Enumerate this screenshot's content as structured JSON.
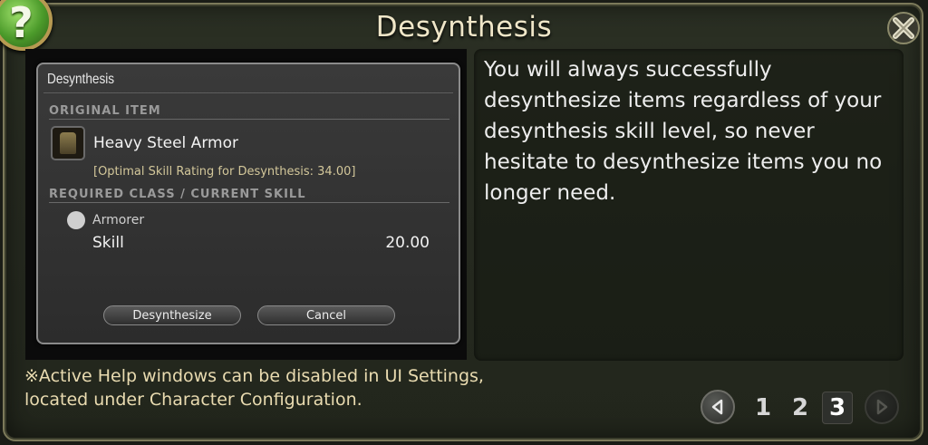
{
  "window": {
    "title": "Desynthesis"
  },
  "dialog": {
    "title": "Desynthesis",
    "original_item_header": "ORIGINAL ITEM",
    "item_name": "Heavy Steel Armor",
    "optimal_rating": "[Optimal Skill Rating for Desynthesis: 34.00]",
    "required_header": "REQUIRED CLASS / CURRENT SKILL",
    "class_name": "Armorer",
    "skill_label": "Skill",
    "skill_value": "20.00",
    "desynthesize_label": "Desynthesize",
    "cancel_label": "Cancel"
  },
  "help_text": "You will always successfully desynthesize items regardless of your desynthesis skill level, so never hesitate to desynthesize items you no longer need.",
  "note": {
    "line1": "※Active Help windows can be disabled in UI Settings,",
    "line2": "located under Character Configuration."
  },
  "pager": {
    "pages": [
      "1",
      "2",
      "3"
    ],
    "current": "3"
  },
  "icons": {
    "help": "question-mark-icon",
    "close": "close-cross-icon",
    "prev": "triangle-left-icon",
    "next": "triangle-right-icon"
  },
  "colors": {
    "accent_gold": "#e9dbb0",
    "help_green": "#4b9a2a",
    "frame": "#7c7a5a"
  }
}
